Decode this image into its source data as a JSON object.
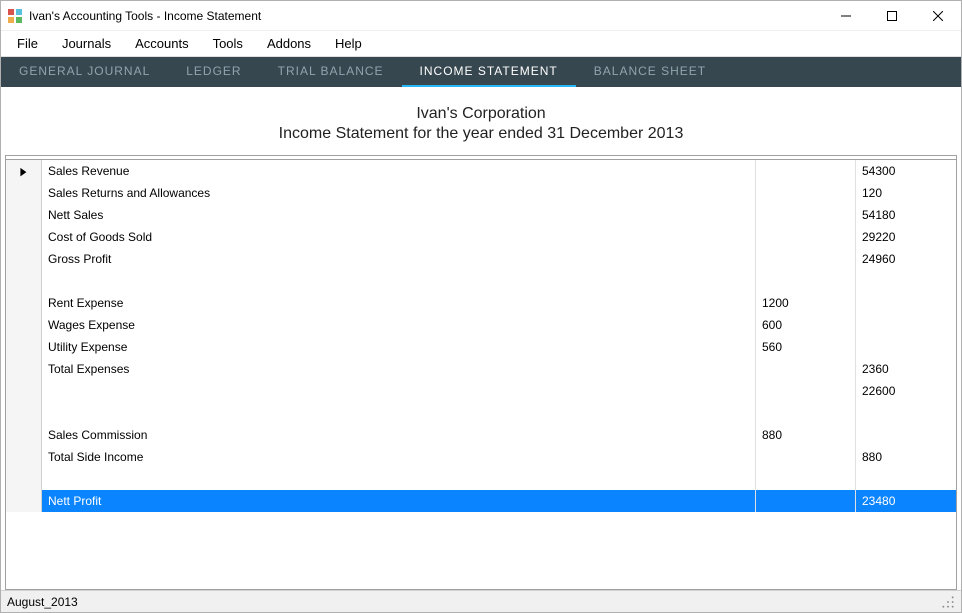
{
  "window": {
    "title": "Ivan's Accounting Tools - Income Statement"
  },
  "menu": {
    "items": [
      "File",
      "Journals",
      "Accounts",
      "Tools",
      "Addons",
      "Help"
    ]
  },
  "tabs": {
    "items": [
      {
        "label": "GENERAL JOURNAL",
        "active": false
      },
      {
        "label": "LEDGER",
        "active": false
      },
      {
        "label": "TRIAL BALANCE",
        "active": false
      },
      {
        "label": "INCOME STATEMENT",
        "active": true
      },
      {
        "label": "BALANCE SHEET",
        "active": false
      }
    ]
  },
  "report": {
    "company": "Ivan's Corporation",
    "subtitle": "Income Statement for the year ended 31 December 2013"
  },
  "rows": [
    {
      "desc": "Sales Revenue",
      "amt1": "",
      "amt2": "54300",
      "current": true
    },
    {
      "desc": "Sales Returns and Allowances",
      "amt1": "",
      "amt2": "120"
    },
    {
      "desc": "Nett Sales",
      "amt1": "",
      "amt2": "54180"
    },
    {
      "desc": "Cost of Goods Sold",
      "amt1": "",
      "amt2": "29220"
    },
    {
      "desc": "Gross Profit",
      "amt1": "",
      "amt2": "24960"
    },
    {
      "desc": "",
      "amt1": "",
      "amt2": ""
    },
    {
      "desc": "Rent Expense",
      "amt1": "1200",
      "amt2": ""
    },
    {
      "desc": "Wages Expense",
      "amt1": "600",
      "amt2": ""
    },
    {
      "desc": "Utility Expense",
      "amt1": "560",
      "amt2": ""
    },
    {
      "desc": "Total Expenses",
      "amt1": "",
      "amt2": "2360"
    },
    {
      "desc": "",
      "amt1": "",
      "amt2": "22600"
    },
    {
      "desc": "",
      "amt1": "",
      "amt2": ""
    },
    {
      "desc": "Sales Commission",
      "amt1": "880",
      "amt2": ""
    },
    {
      "desc": "Total Side Income",
      "amt1": "",
      "amt2": "880"
    },
    {
      "desc": "",
      "amt1": "",
      "amt2": ""
    },
    {
      "desc": "Nett Profit",
      "amt1": "",
      "amt2": "23480",
      "selected": true
    }
  ],
  "status": {
    "text": "August_2013"
  }
}
